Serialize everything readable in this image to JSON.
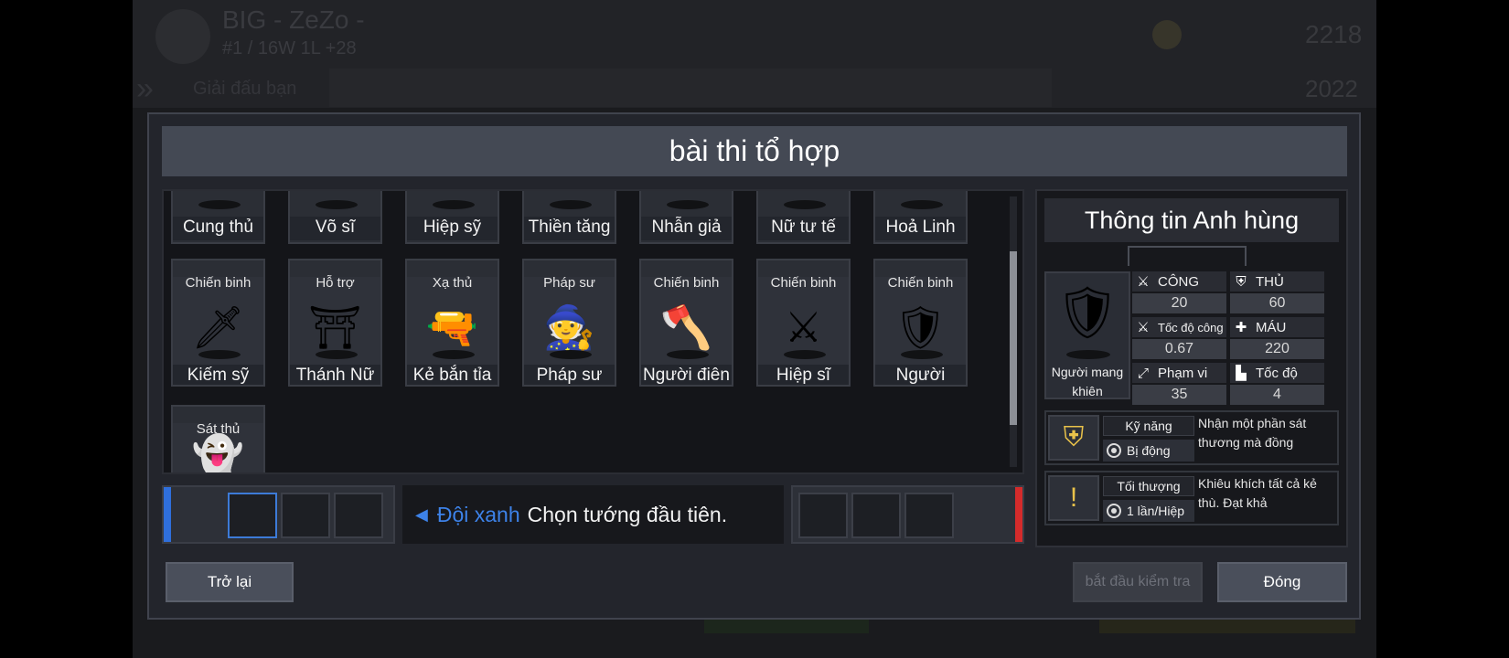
{
  "background": {
    "player_name": "BIG - ZeZo -",
    "player_rank": "#1 / 16W 1L +28",
    "league_label": "Giải đấu bạn",
    "score_top": "2218",
    "score_bottom": "2022"
  },
  "modal": {
    "title": "bài thi tổ hợp"
  },
  "heroes_top_row": [
    {
      "name": "Cung thủ",
      "glyph": "🏹"
    },
    {
      "name": "Võ sĩ",
      "glyph": "🥋"
    },
    {
      "name": "Hiệp sỹ",
      "glyph": "🛡"
    },
    {
      "name": "Thiền tăng",
      "glyph": "🧘"
    },
    {
      "name": "Nhẫn giả",
      "glyph": "🥷"
    },
    {
      "name": "Nữ tư tế",
      "glyph": "🕯"
    },
    {
      "name": "Hoả Linh",
      "glyph": "🔥"
    }
  ],
  "heroes": [
    {
      "class": "Chiến binh",
      "name": "Kiếm sỹ",
      "glyph": "🗡"
    },
    {
      "class": "Hỗ trợ",
      "name": "Thánh Nữ",
      "glyph": "⛩"
    },
    {
      "class": "Xạ thủ",
      "name": "Kẻ bắn tỉa",
      "glyph": "🔫"
    },
    {
      "class": "Pháp sư",
      "name": "Pháp sư",
      "glyph": "🧙"
    },
    {
      "class": "Chiến binh",
      "name": "Người điên",
      "glyph": "🪓"
    },
    {
      "class": "Chiến binh",
      "name": "Hiệp sĩ",
      "glyph": "⚔"
    },
    {
      "class": "Chiến binh",
      "name": "Người",
      "glyph": "🛡"
    }
  ],
  "heroes_bottom_row": [
    {
      "class": "Sát thủ",
      "glyph": "👻"
    }
  ],
  "pick": {
    "team_label": "Đội xanh",
    "message": "Chọn tướng đầu tiên."
  },
  "hero_info": {
    "title": "Thông tin Anh hùng",
    "hero_name": "Người mang khiên",
    "hero_glyph": "🛡",
    "stats": {
      "attack": {
        "label": "CÔNG",
        "value": "20",
        "icon": "sword-icon"
      },
      "defense": {
        "label": "THỦ",
        "value": "60",
        "icon": "shield-icon"
      },
      "attack_speed": {
        "label": "Tốc độ công",
        "value": "0.67",
        "icon": "double-sword-icon"
      },
      "hp": {
        "label": "MÁU",
        "value": "220",
        "icon": "plus-icon"
      },
      "range": {
        "label": "Phạm vi",
        "value": "35",
        "icon": "range-icon"
      },
      "speed": {
        "label": "Tốc độ",
        "value": "4",
        "icon": "boot-icon"
      }
    },
    "skill": {
      "name": "Kỹ năng",
      "type": "Bị động",
      "description": "Nhận một phần sát thương mà đồng",
      "icon": "skill-shield-icon"
    },
    "ultimate": {
      "name": "Tối thượng",
      "type": "1 lần/Hiệp",
      "description": "Khiêu khích tất cả kẻ thù. Đạt khả",
      "icon": "ultimate-taunt-icon"
    }
  },
  "buttons": {
    "back": "Trở lại",
    "start": "bắt đầu kiểm tra",
    "close": "Đóng"
  },
  "colors": {
    "team_blue": "#3d82e8",
    "team_red": "#d42b2b",
    "panel": "#23252c"
  }
}
